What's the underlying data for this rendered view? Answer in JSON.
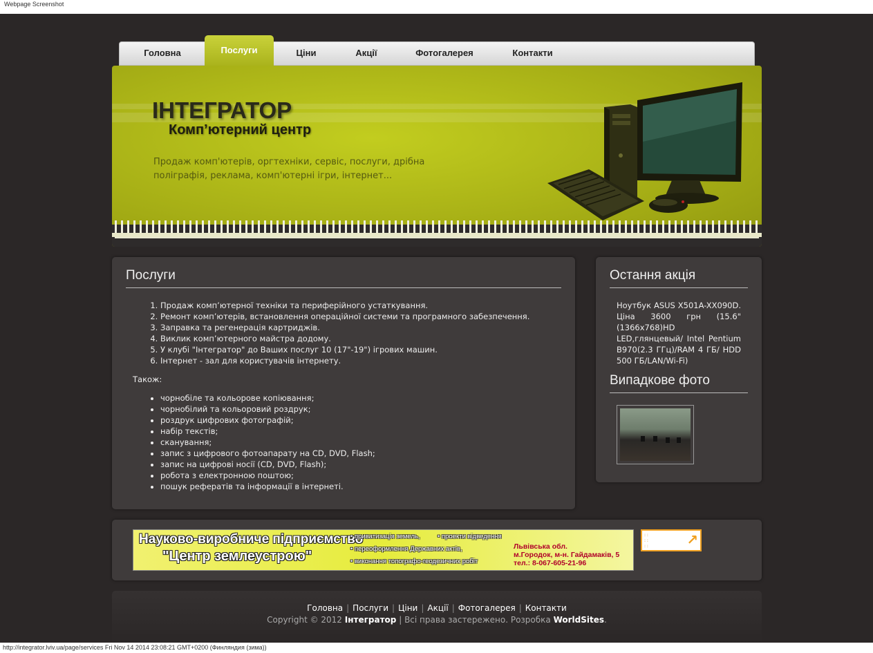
{
  "caption": "Webpage Screenshot",
  "status_bar": "http://integrator.lviv.ua/page/services Fri Nov 14 2014 23:08:21 GMT+0200 (Финляндия (зима))",
  "nav": {
    "items": [
      {
        "label": "Головна",
        "active": false
      },
      {
        "label": "Послуги",
        "active": true
      },
      {
        "label": "Ціни",
        "active": false
      },
      {
        "label": "Акції",
        "active": false
      },
      {
        "label": "Фотогалерея",
        "active": false
      },
      {
        "label": "Контакти",
        "active": false
      }
    ]
  },
  "header": {
    "title": "ІНТЕГРАТОР",
    "subtitle": "Комп’ютерний центр",
    "tagline": "Продаж комп'ютерів, оргтехніки, сервіс, послуги, дрібна поліграфія, реклама, комп'ютерні ігри, інтернет...",
    "accent_color": "#b5c01a"
  },
  "main": {
    "heading": "Послуги",
    "services": [
      "Продаж комп’ютерної техніки та периферійного устаткування.",
      "Ремонт комп’ютерів, встановлення операційної системи та програмного забезпечення.",
      "Заправка та регенерація картриджів.",
      "Виклик комп’ютерного майстра додому.",
      "У клубі \"Інтегратор\" до Ваших послуг 10 (17\"-19\") ігрових машин.",
      "Інтернет - зал для користувачів інтернету."
    ],
    "also_label": "Також:",
    "extras": [
      "чорнобіле та кольорове копіювання;",
      "чорнобілий та кольоровий роздрук;",
      "роздрук цифрових фотографій;",
      "набір текстів;",
      "сканування;",
      "запис з цифрового фотоапарату на CD, DVD, Flash;",
      "запис на цифрові носії (CD, DVD, Flash);",
      "робота з електронною поштою;",
      "пошук рефератів та інформації в інтернеті."
    ]
  },
  "sidebar": {
    "promo_heading": "Остання акція",
    "promo_text": "Ноутбук ASUS X501A-XX090D. Ціна 3600 грн (15.6\" (1366x768)HD LED,глянцевый/ Intel Pentium B970(2.3 ГГц)/RAM 4 ГБ/ HDD 500 ГБ/LAN/Wi-Fi)",
    "photo_heading": "Випадкове фото"
  },
  "banner": {
    "title_line1": "Науково-виробниче підприємство",
    "title_line2": "\"Центр землеустрою\"",
    "bullets": [
      "приватизація земель,",
      "проекти відведення",
      "переоформлення Державних актів,",
      "виконання топографо-геодезичних робіт"
    ],
    "address_line1": "Львівська обл.",
    "address_line2": "м.Городок, м-н. Гайдамаків, 5",
    "phone": "тел.: 8-067-605-21-96"
  },
  "footer": {
    "links": [
      "Головна",
      "Послуги",
      "Ціни",
      "Акції",
      "Фотогалерея",
      "Контакти"
    ],
    "copyright_prefix": "Copyright © 2012",
    "brand": "Інтегратор",
    "rights": "| Всі права застережено. Розробка",
    "developer": "WorldSites",
    "suffix": "."
  }
}
